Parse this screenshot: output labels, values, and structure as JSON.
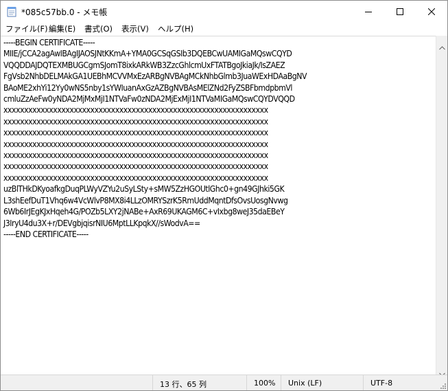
{
  "window": {
    "title": "*085c57bb.0 - メモ帳"
  },
  "menu": {
    "items": [
      {
        "label": "ファイル(F)",
        "name": "menu-file"
      },
      {
        "label": "編集(E)",
        "name": "menu-edit"
      },
      {
        "label": "書式(O)",
        "name": "menu-format"
      },
      {
        "label": "表示(V)",
        "name": "menu-view"
      },
      {
        "label": "ヘルプ(H)",
        "name": "menu-help"
      }
    ]
  },
  "editor": {
    "lines": [
      "-----BEGIN CERTIFICATE-----",
      "MIIE/jCCA2agAwIBAgIJAOSJNtKKmA+YMA0GCSqGSIb3DQEBCwUAMIGaMQswCQYD",
      "VQQDDAJDQTEXMBUGCgmSJomT8ixkARkWB3ZzcGhlcmUxFTATBgoJkiaJk/IsZAEZ",
      "FgVsb2NhbDELMAkGA1UEBhMCVVMxEzARBgNVBAgMCkNhbGlmb3JuaWExHDAaBgNV",
      "BAoME2xhYi12Yy0wNS5nby1sYWIuanAxGzAZBgNVBAsMElZNd2FyZSBFbmdpbmVl",
      "cmluZzAeFw0yNDA2MjMxMjI1NTVaFw0zNDA2MjExMjI1NTVaMIGaMQswCQYDVQQD",
      "xxxxxxxxxxxxxxxxxxxxxxxxxxxxxxxxxxxxxxxxxxxxxxxxxxxxxxxxxxxxxxxx",
      "xxxxxxxxxxxxxxxxxxxxxxxxxxxxxxxxxxxxxxxxxxxxxxxxxxxxxxxxxxxxxxxx",
      "xxxxxxxxxxxxxxxxxxxxxxxxxxxxxxxxxxxxxxxxxxxxxxxxxxxxxxxxxxxxxxxx",
      "xxxxxxxxxxxxxxxxxxxxxxxxxxxxxxxxxxxxxxxxxxxxxxxxxxxxxxxxxxxxxxxx",
      "xxxxxxxxxxxxxxxxxxxxxxxxxxxxxxxxxxxxxxxxxxxxxxxxxxxxxxxxxxxxxxxx",
      "xxxxxxxxxxxxxxxxxxxxxxxxxxxxxxxxxxxxxxxxxxxxxxxxxxxxxxxxxxxxxxxx",
      "xxxxxxxxxxxxxxxxxxxxxxxxxxxxxxxxxxxxxxxxxxxxxxxxxxxxxxxxxxxxxxxx",
      "uzBlTHkDKyoafkgDuqPLWyVZYu2uSyLSty+sMW5ZzHGOUtlGhc0+gn49GJhki5GK",
      "L3shEefDuT1Vhq6w4VcWlvP8MX8i4LLzOMRYSzrK5RmUddMqntDfsOvsUosgNvwg",
      "6Wb6IrJEgKJxHqeh4G/POZb5LXY2jNABe+AxR69UKAGM6C+vIxbg8weJ35daEBeY",
      "J3IryU4du3X+r/DEVgbjqisrNIU6MptLLKpqkX//sWodvA==",
      "-----END CERTIFICATE-----"
    ]
  },
  "status": {
    "position": "13 行、65 列",
    "zoom": "100%",
    "eol": "Unix (LF)",
    "encoding": "UTF-8"
  },
  "icons": {
    "app": "notepad-icon",
    "minimize": "minimize-icon",
    "maximize": "maximize-icon",
    "close": "close-icon"
  }
}
